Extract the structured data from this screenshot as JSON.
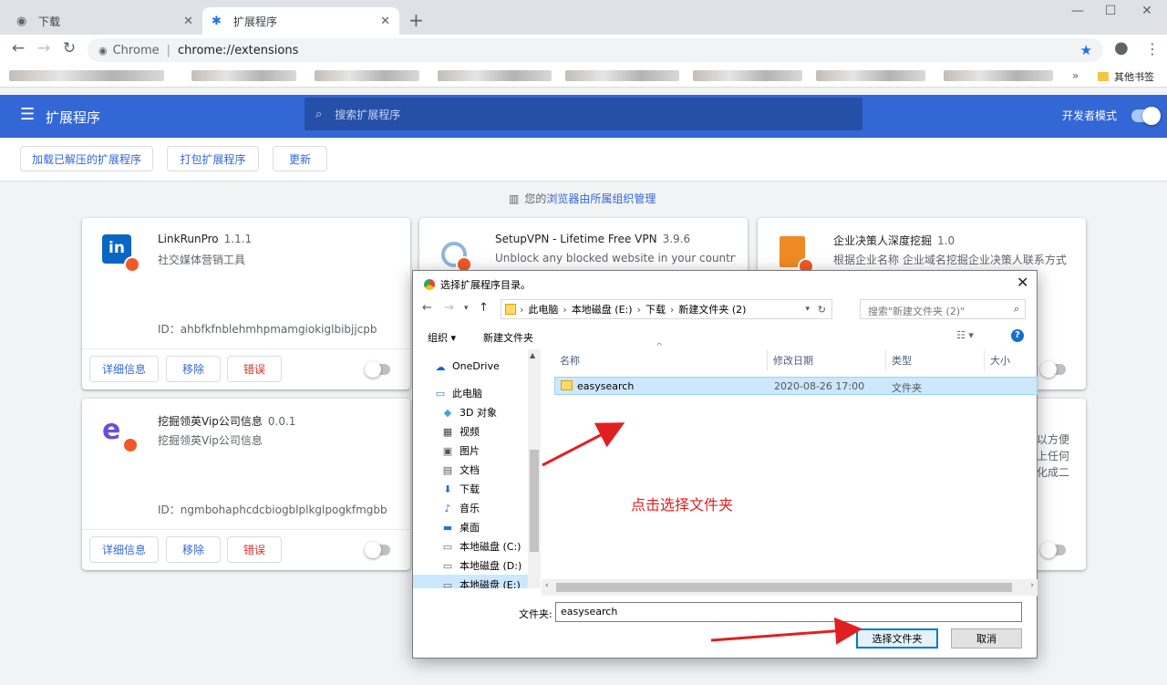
{
  "tabs": [
    {
      "title": "下载",
      "icon": "globe-icon"
    },
    {
      "title": "扩展程序",
      "icon": "puzzle-icon"
    }
  ],
  "window_controls": {
    "minimize": "—",
    "maximize": "☐",
    "close": "✕"
  },
  "omnibox": {
    "site": "Chrome",
    "url": "chrome://extensions"
  },
  "bookmarks": {
    "other_label": "其他书签",
    "overflow": "»"
  },
  "header": {
    "title": "扩展程序",
    "search_placeholder": "搜索扩展程序",
    "dev_mode_label": "开发者模式",
    "dev_mode_on": true
  },
  "actions": {
    "load_unpacked": "加载已解压的扩展程序",
    "pack": "打包扩展程序",
    "update": "更新"
  },
  "managed": {
    "prefix": "您的",
    "link": "浏览器由所属组织管理"
  },
  "cards": [
    {
      "name": "LinkRunPro",
      "version": "1.1.1",
      "desc": "社交媒体营销工具",
      "id": "ID：ahbfkfnblehmhpmamgiokiglbibjjcpb",
      "details": "详细信息",
      "remove": "移除",
      "errors": "错误",
      "icon": "linkedin-icon"
    },
    {
      "name": "SetupVPN - Lifetime Free VPN",
      "version": "3.9.6",
      "desc": "Unblock any blocked website in your country,",
      "icon": "vpn-icon"
    },
    {
      "name": "企业决策人深度挖掘",
      "version": "1.0",
      "desc": "根据企业名称 企业域名挖掘企业决策人联系方式",
      "icon": "building-icon"
    },
    {
      "name": "挖掘领英Vip公司信息",
      "version": "0.0.1",
      "desc": "挖掘领英Vip公司信息",
      "id": "ID：ngmbohaphcdcbiogblplkglpogkfmgbb",
      "details": "详细信息",
      "remove": "移除",
      "errors": "错误",
      "icon": "e-logo-icon"
    }
  ],
  "partial_card_text": [
    "以方便",
    "上任何",
    "化成二"
  ],
  "dialog": {
    "title": "选择扩展程序目录。",
    "path": [
      "此电脑",
      "本地磁盘 (E:)",
      "下载",
      "新建文件夹 (2)"
    ],
    "search_placeholder": "搜索\"新建文件夹 (2)\"",
    "organize": "组织 ▾",
    "new_folder": "新建文件夹",
    "nav_items": [
      {
        "label": "OneDrive",
        "icon": "cloud-icon"
      },
      {
        "label": "此电脑",
        "icon": "computer-icon"
      },
      {
        "label": "3D 对象",
        "icon": "cube-icon"
      },
      {
        "label": "视频",
        "icon": "video-icon"
      },
      {
        "label": "图片",
        "icon": "picture-icon"
      },
      {
        "label": "文档",
        "icon": "document-icon"
      },
      {
        "label": "下载",
        "icon": "download-icon"
      },
      {
        "label": "音乐",
        "icon": "music-icon"
      },
      {
        "label": "桌面",
        "icon": "desktop-icon"
      },
      {
        "label": "本地磁盘 (C:)",
        "icon": "drive-icon"
      },
      {
        "label": "本地磁盘 (D:)",
        "icon": "drive-icon"
      },
      {
        "label": "本地磁盘 (E:)",
        "icon": "drive-icon"
      }
    ],
    "columns": {
      "name": "名称",
      "modified": "修改日期",
      "type": "类型",
      "size": "大小"
    },
    "files": [
      {
        "name": "easysearch",
        "modified": "2020-08-26 17:00",
        "type": "文件夹"
      }
    ],
    "folder_label": "文件夹:",
    "folder_value": "easysearch",
    "select_button": "选择文件夹",
    "cancel_button": "取消"
  },
  "annotation": "点击选择文件夹",
  "colors": {
    "accent": "#3367d6",
    "annotation": "#e02020"
  }
}
